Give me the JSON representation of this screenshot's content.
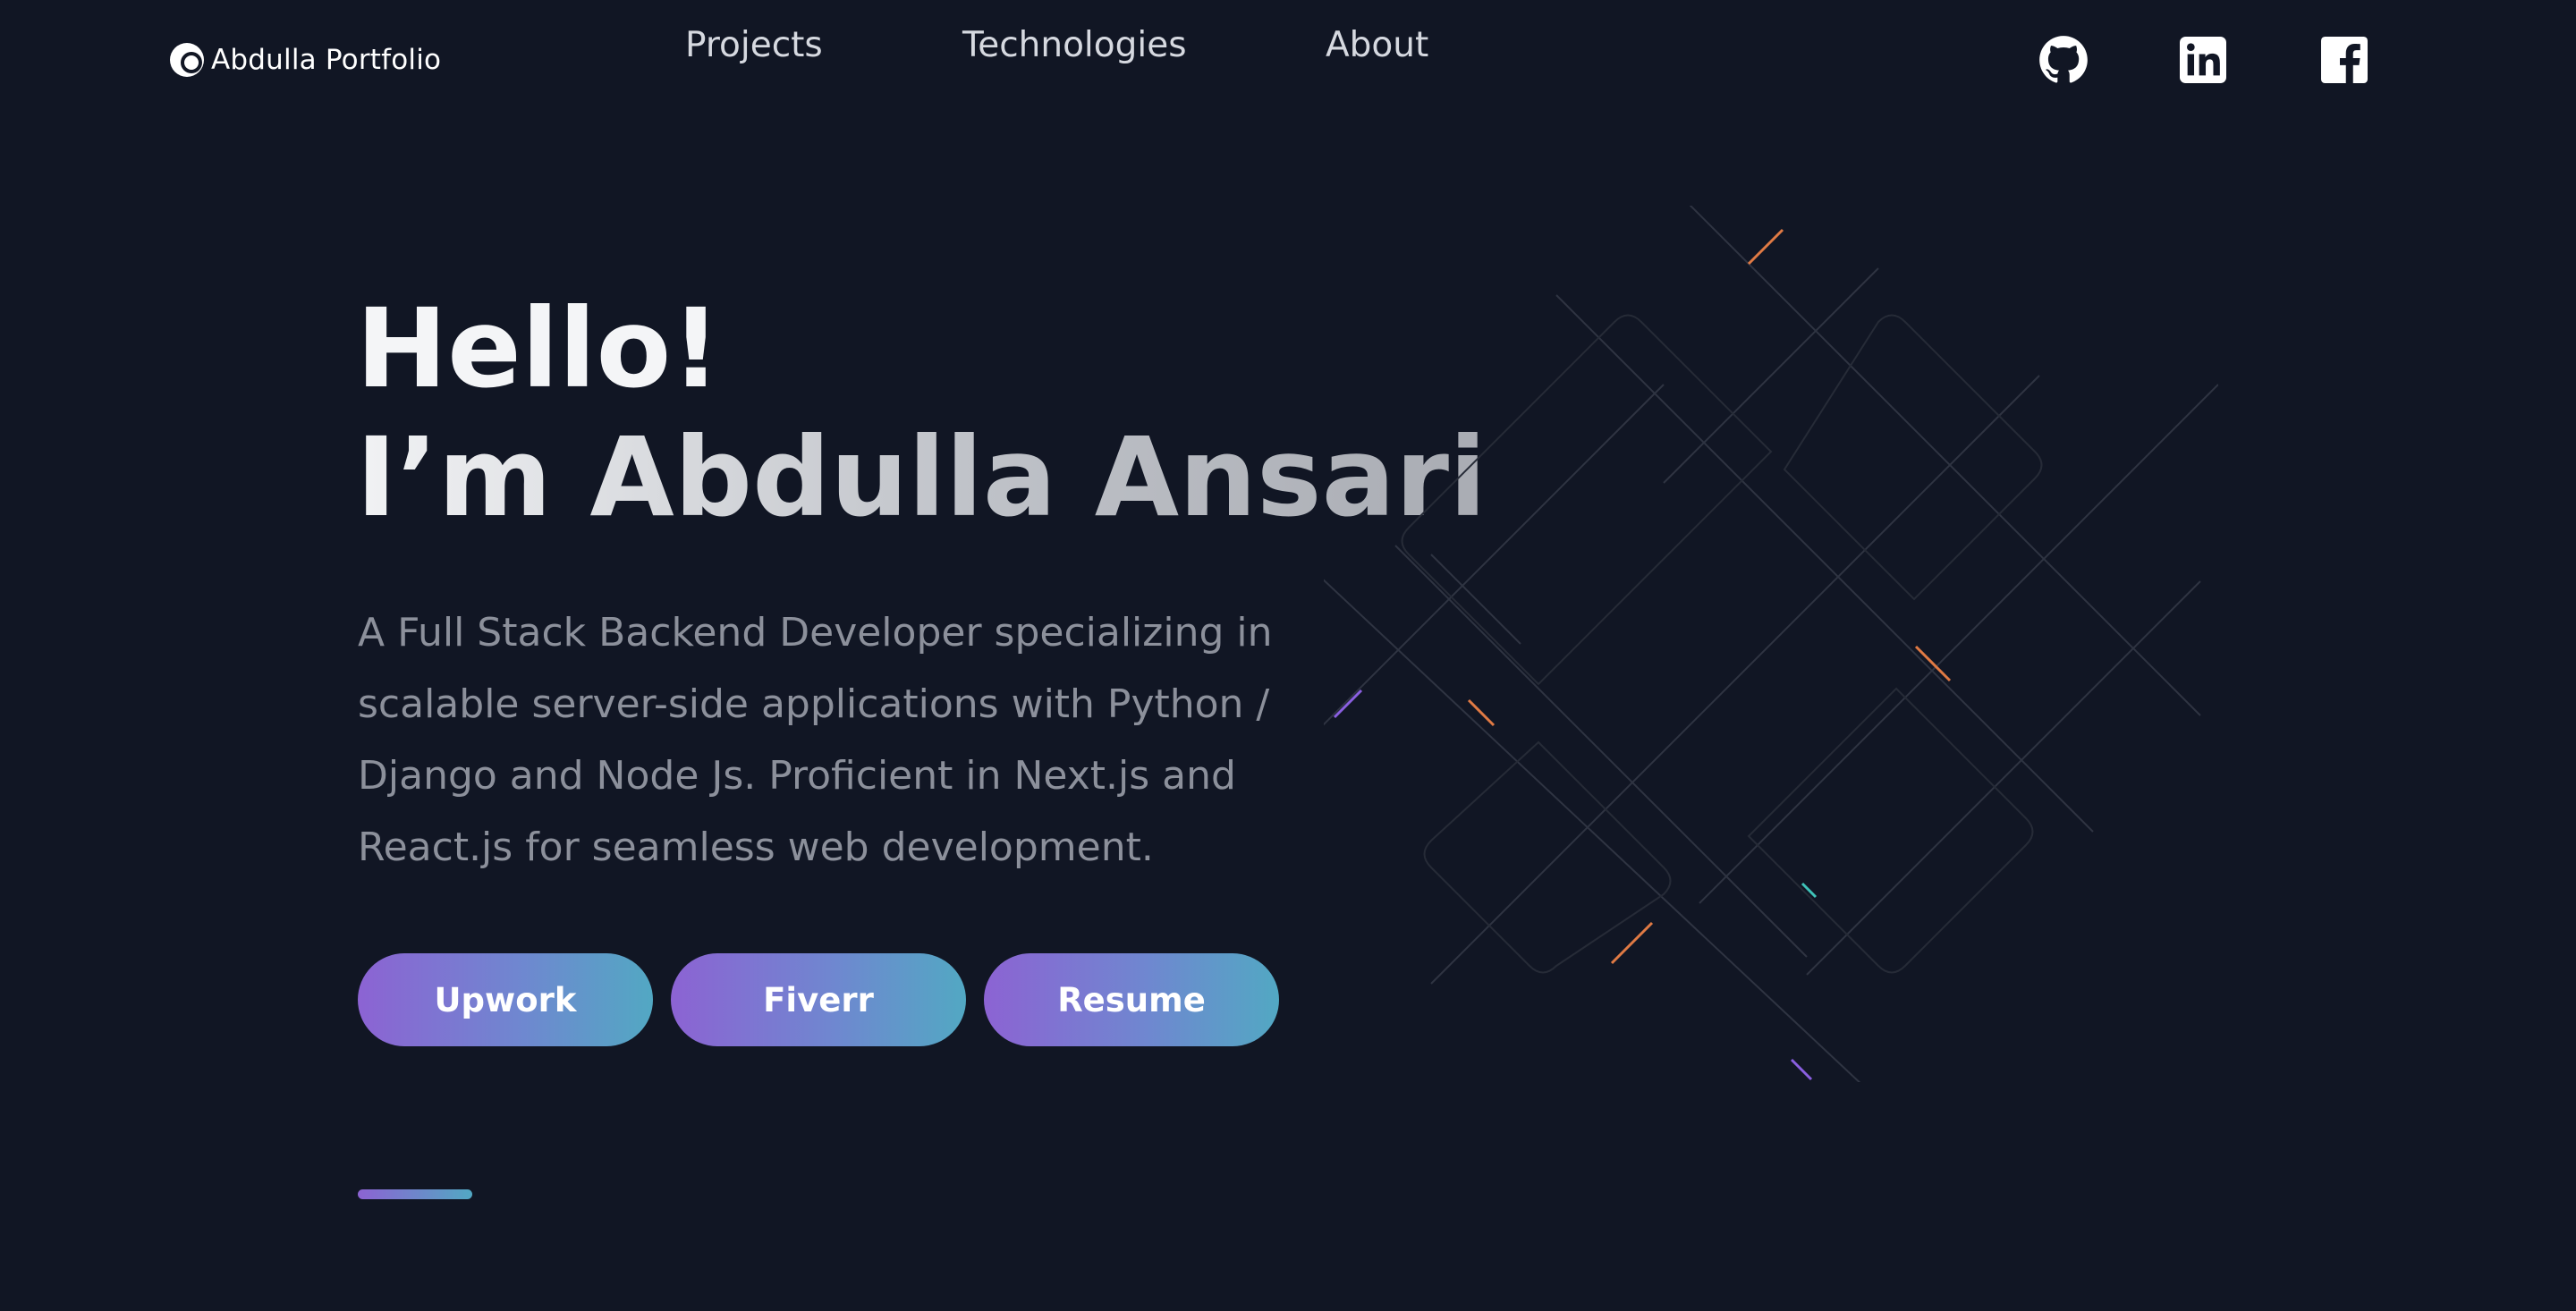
{
  "header": {
    "logo_text": "Abdulla Portfolio",
    "logo_icon": "portfolio-logo-icon",
    "nav": [
      {
        "label": "Projects"
      },
      {
        "label": "Technologies"
      },
      {
        "label": "About"
      }
    ],
    "social_icons": [
      "github-icon",
      "linkedin-icon",
      "facebook-icon"
    ]
  },
  "hero": {
    "greeting": "Hello!",
    "name_line": "I’m Abdulla Ansari",
    "description": "A Full Stack Backend Developer specializing in scalable server-side applications with Python / Django and Node Js. Proficient in Next.js and React.js for seamless web development.",
    "buttons": [
      {
        "label": "Upwork"
      },
      {
        "label": "Fiverr"
      },
      {
        "label": "Resume"
      }
    ]
  },
  "colors": {
    "background": "#111624",
    "text_primary": "#f4f5f7",
    "text_muted": "#8c909b",
    "gradient_start": "#8c63d3",
    "gradient_end": "#52a8c3",
    "accent_orange": "#e07a44",
    "accent_teal": "#3fc2b8",
    "accent_purple": "#8a5fe0"
  }
}
